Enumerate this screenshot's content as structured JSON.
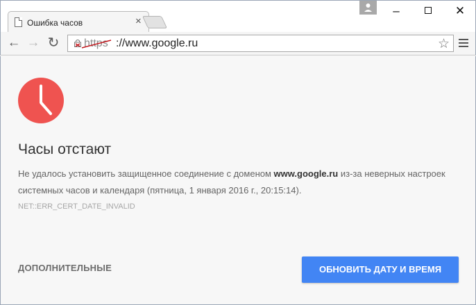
{
  "browser": {
    "tab": {
      "title": "Ошибка часов",
      "close_glyph": "×"
    },
    "window_controls": {
      "minimize": "–",
      "close": "✕"
    },
    "toolbar": {
      "back": "←",
      "forward": "→",
      "reload": "↻",
      "url_scheme": "https",
      "url_rest": "://www.google.ru",
      "star": "☆"
    }
  },
  "error_page": {
    "headline": "Часы отстают",
    "description_before": "Не удалось установить защищенное соединение с доменом ",
    "description_domain": "www.google.ru",
    "description_after": " из-за неверных настроек системных часов и календаря (пятница, 1 января 2016 г., 20:15:14).",
    "error_code": "NET::ERR_CERT_DATE_INVALID",
    "details_button": "ДОПОЛНИТЕЛЬНЫЕ",
    "primary_button": "ОБНОВИТЬ ДАТУ И ВРЕМЯ"
  },
  "colors": {
    "clock_red": "#ef5350",
    "primary_blue": "#4285f4",
    "invalid_cert_red": "#c4161c"
  },
  "icons": [
    "page-icon",
    "person-icon",
    "back-arrow-icon",
    "forward-arrow-icon",
    "reload-icon",
    "not-secure-lock-icon",
    "star-icon",
    "menu-icon",
    "clock-icon"
  ]
}
